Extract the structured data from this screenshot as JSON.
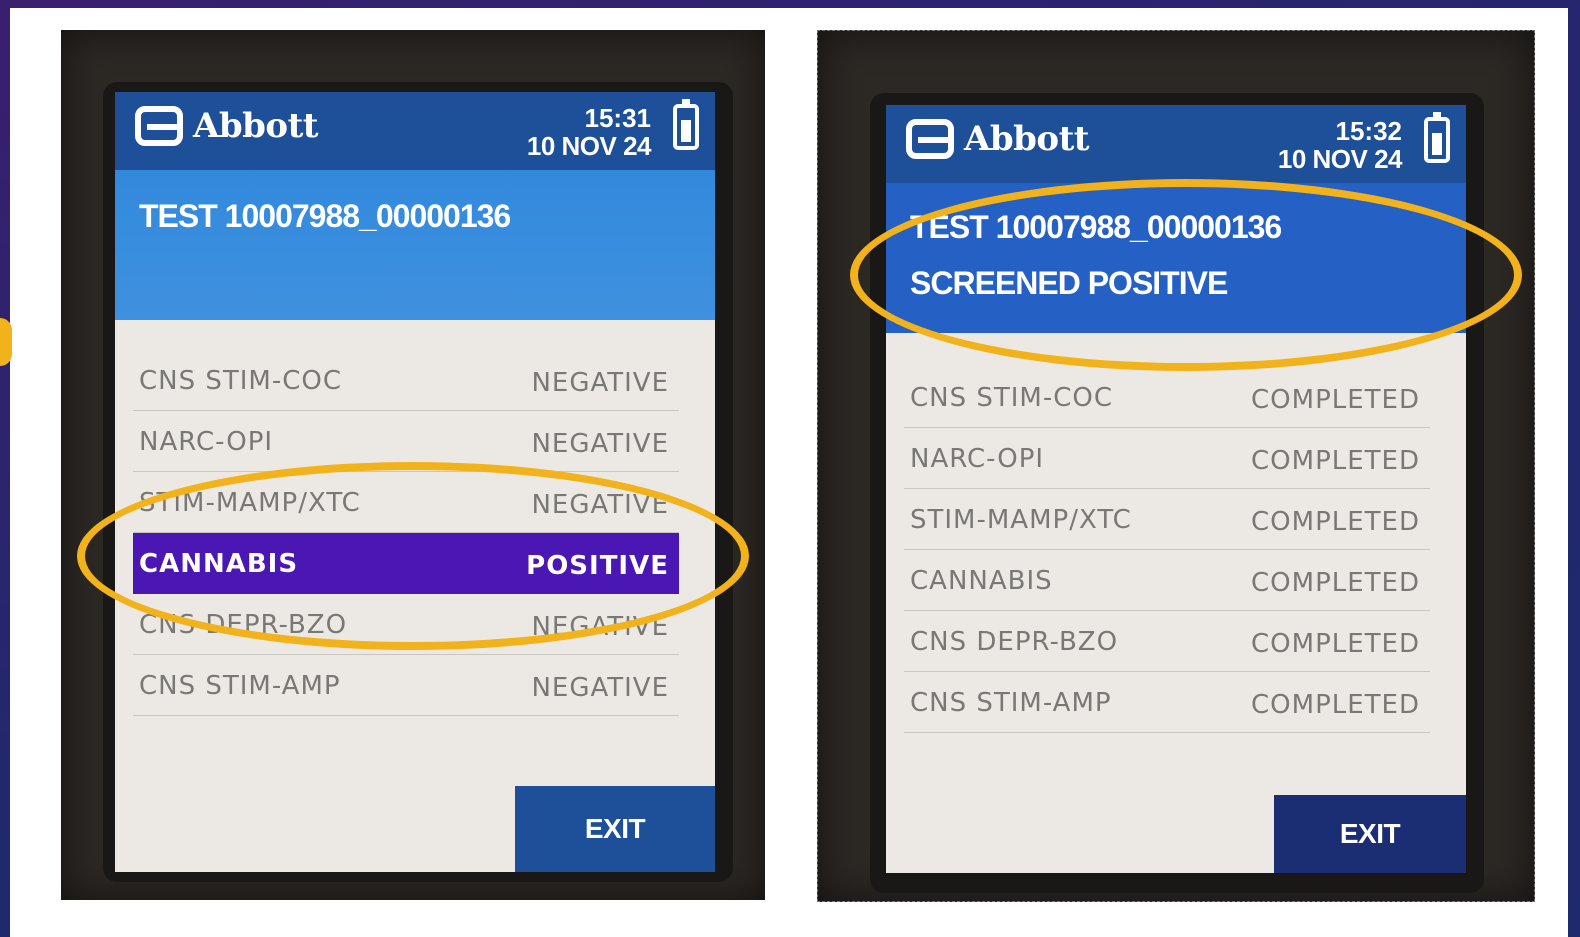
{
  "colors": {
    "brand_blue": "#1e4f99",
    "header_light_blue": "#3289dc",
    "positive_purple": "#4a16b4",
    "highlight_ring": "#f2b21b"
  },
  "screens": [
    {
      "brand": "Abbott",
      "time": "15:31",
      "date": "10 NOV 24",
      "title": "TEST 10007988_00000136",
      "subtitle": "",
      "results": [
        {
          "name": "CNS STIM-COC",
          "status": "NEGATIVE"
        },
        {
          "name": "NARC-OPI",
          "status": "NEGATIVE"
        },
        {
          "name": "STIM-MAMP/XTC",
          "status": "NEGATIVE"
        },
        {
          "name": "CANNABIS",
          "status": "POSITIVE"
        },
        {
          "name": "CNS DEPR-BZO",
          "status": "NEGATIVE"
        },
        {
          "name": "CNS STIM-AMP",
          "status": "NEGATIVE"
        }
      ],
      "exit_label": "EXIT"
    },
    {
      "brand": "Abbott",
      "time": "15:32",
      "date": "10 NOV 24",
      "title": "TEST 10007988_00000136",
      "subtitle": "SCREENED POSITIVE",
      "results": [
        {
          "name": "CNS STIM-COC",
          "status": "COMPLETED"
        },
        {
          "name": "NARC-OPI",
          "status": "COMPLETED"
        },
        {
          "name": "STIM-MAMP/XTC",
          "status": "COMPLETED"
        },
        {
          "name": "CANNABIS",
          "status": "COMPLETED"
        },
        {
          "name": "CNS DEPR-BZO",
          "status": "COMPLETED"
        },
        {
          "name": "CNS STIM-AMP",
          "status": "COMPLETED"
        }
      ],
      "exit_label": "EXIT"
    }
  ]
}
